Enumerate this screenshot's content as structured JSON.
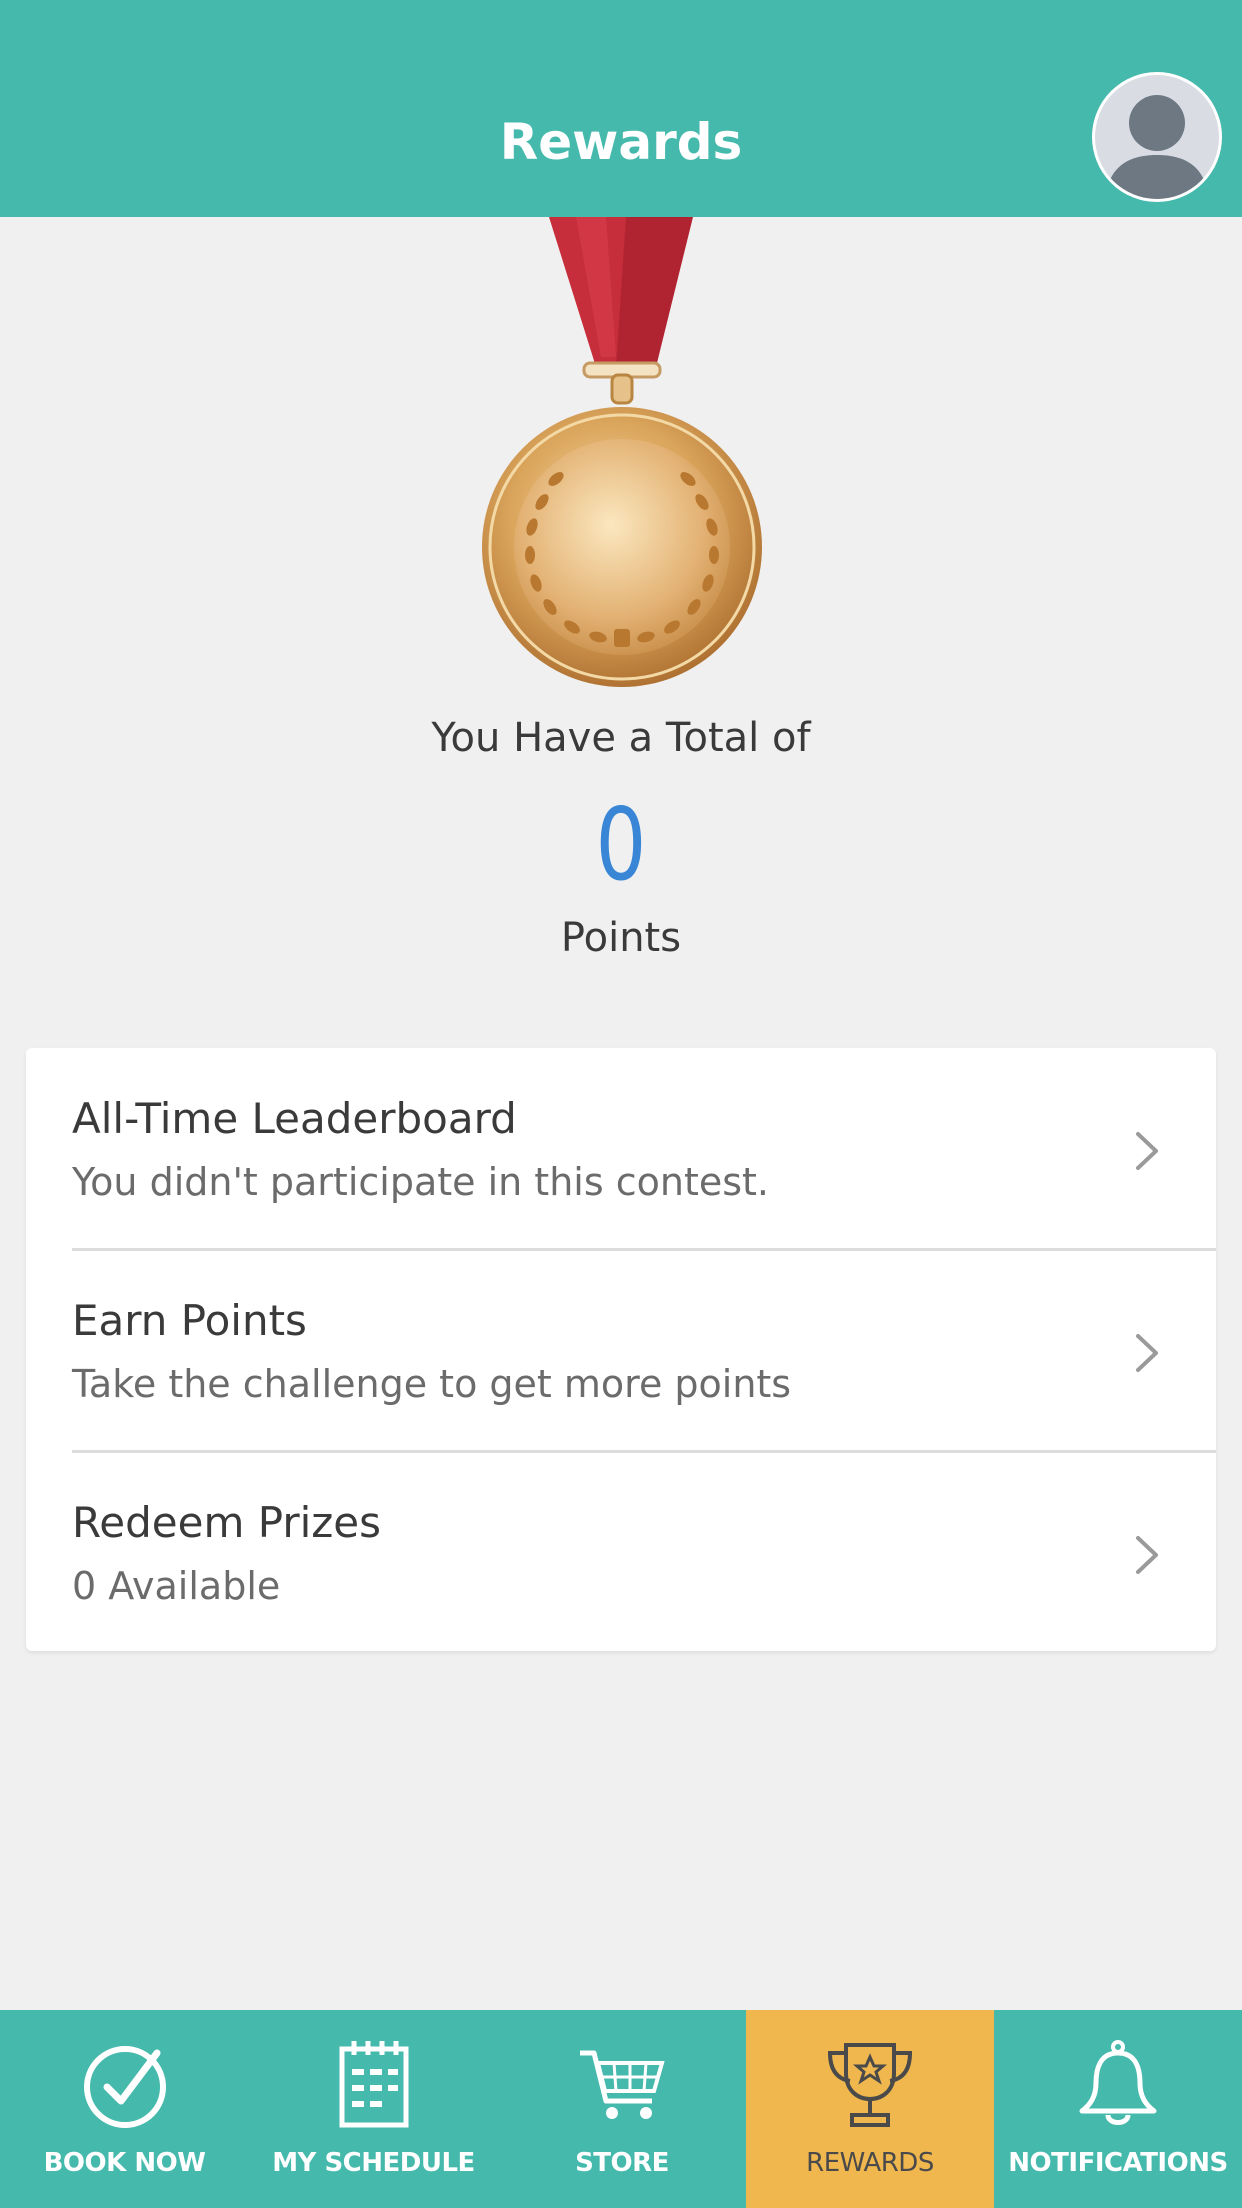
{
  "header": {
    "title": "Rewards"
  },
  "points": {
    "total_label": "You Have a Total of",
    "value": "0",
    "unit_label": "Points"
  },
  "menu": [
    {
      "title": "All-Time Leaderboard",
      "subtitle": "You didn't participate in this contest."
    },
    {
      "title": "Earn Points",
      "subtitle": "Take the challenge to get more points"
    },
    {
      "title": "Redeem Prizes",
      "subtitle": "0 Available"
    }
  ],
  "tabs": [
    {
      "label": "BOOK NOW",
      "icon": "check-circle-icon"
    },
    {
      "label": "MY SCHEDULE",
      "icon": "calendar-icon"
    },
    {
      "label": "STORE",
      "icon": "cart-icon"
    },
    {
      "label": "REWARDS",
      "icon": "trophy-icon",
      "active": true
    },
    {
      "label": "NOTIFICATIONS",
      "icon": "bell-icon"
    }
  ],
  "colors": {
    "header": "#44b9ac",
    "active_tab": "#efb74e",
    "points_value": "#3a86d6",
    "background": "#f0f0f0"
  }
}
